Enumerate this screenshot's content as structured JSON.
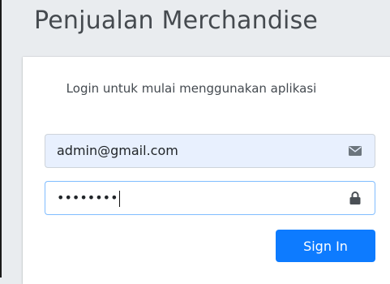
{
  "app": {
    "title": "Penjualan Merchandise"
  },
  "login": {
    "message": "Login untuk mulai menggunakan aplikasi",
    "email": {
      "value": "admin@gmail.com",
      "icon": "envelope-icon"
    },
    "password": {
      "masked_value": "••••••••",
      "icon": "lock-icon"
    },
    "signin_label": "Sign In"
  },
  "colors": {
    "primary": "#0d7bff",
    "autofill": "#e8f0fe",
    "focus_border": "#80bdff"
  }
}
